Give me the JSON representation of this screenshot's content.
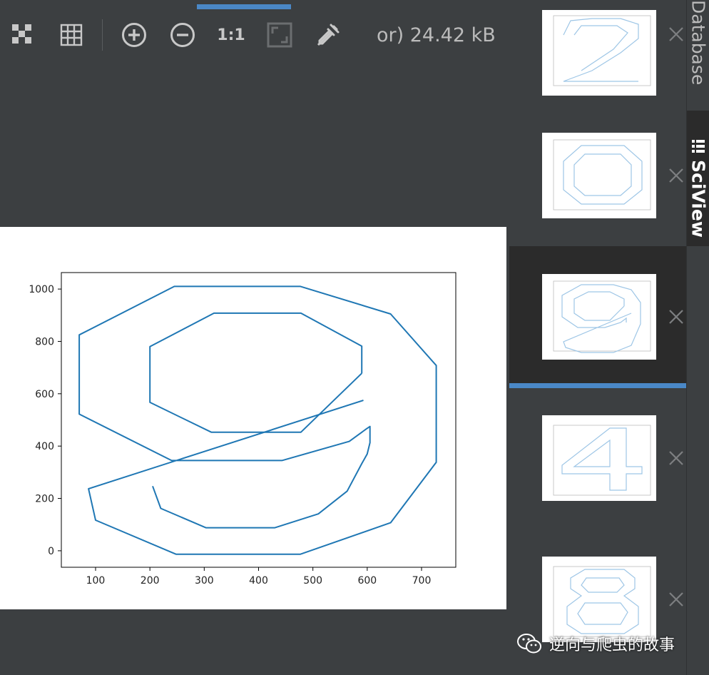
{
  "toolbar": {
    "items": [
      {
        "name": "checkerboard-icon",
        "title": "Show chessboard"
      },
      {
        "name": "grid-icon",
        "title": "Show grid"
      },
      {
        "name": "zoom-in-icon",
        "title": "Zoom in"
      },
      {
        "name": "zoom-out-icon",
        "title": "Zoom out"
      },
      {
        "name": "actual-size-icon",
        "title": "1:1"
      },
      {
        "name": "fit-to-window-icon",
        "title": "Fit to window"
      },
      {
        "name": "color-picker-icon",
        "title": "Color picker"
      }
    ],
    "actual_size_label": "1:1",
    "image_info": "or) 24.42 kB"
  },
  "tool_windows": {
    "database_label": "Database",
    "sciview_label": "SciView",
    "active": "SciView"
  },
  "thumbnails": {
    "close_icon": "close-icon",
    "selected_index": 2,
    "items": [
      {
        "digit": "2"
      },
      {
        "digit": "0"
      },
      {
        "digit": "9"
      },
      {
        "digit": "4"
      },
      {
        "digit": "8"
      }
    ]
  },
  "chart_data": {
    "type": "line",
    "title": "",
    "xlabel": "",
    "ylabel": "",
    "xlim": [
      37,
      763
    ],
    "ylim": [
      -63,
      1063
    ],
    "xticks": [
      100,
      200,
      300,
      400,
      500,
      600,
      700
    ],
    "yticks": [
      0,
      200,
      400,
      600,
      800,
      1000
    ],
    "grid": false,
    "line_color": "#1f77b4",
    "series": [
      {
        "x": [
          593,
          87,
          100,
          248,
          477,
          643,
          727,
          727,
          643,
          477,
          245,
          70,
          70,
          240,
          443,
          567,
          598,
          605,
          605,
          600,
          590,
          563,
          510,
          430,
          303,
          220,
          205
        ],
        "y": [
          575,
          237,
          117,
          -13,
          -13,
          107,
          338,
          708,
          905,
          1010,
          1010,
          825,
          522,
          345,
          345,
          418,
          465,
          475,
          413,
          370,
          333,
          228,
          141,
          88,
          88,
          162,
          247
        ]
      },
      {
        "x": [
          590,
          590,
          478,
          318,
          200,
          200,
          313,
          478,
          590
        ],
        "y": [
          678,
          782,
          908,
          908,
          780,
          567,
          453,
          453,
          678
        ]
      }
    ]
  },
  "watermark": {
    "text": "逆向与爬虫的故事",
    "icon": "wechat-icon"
  }
}
